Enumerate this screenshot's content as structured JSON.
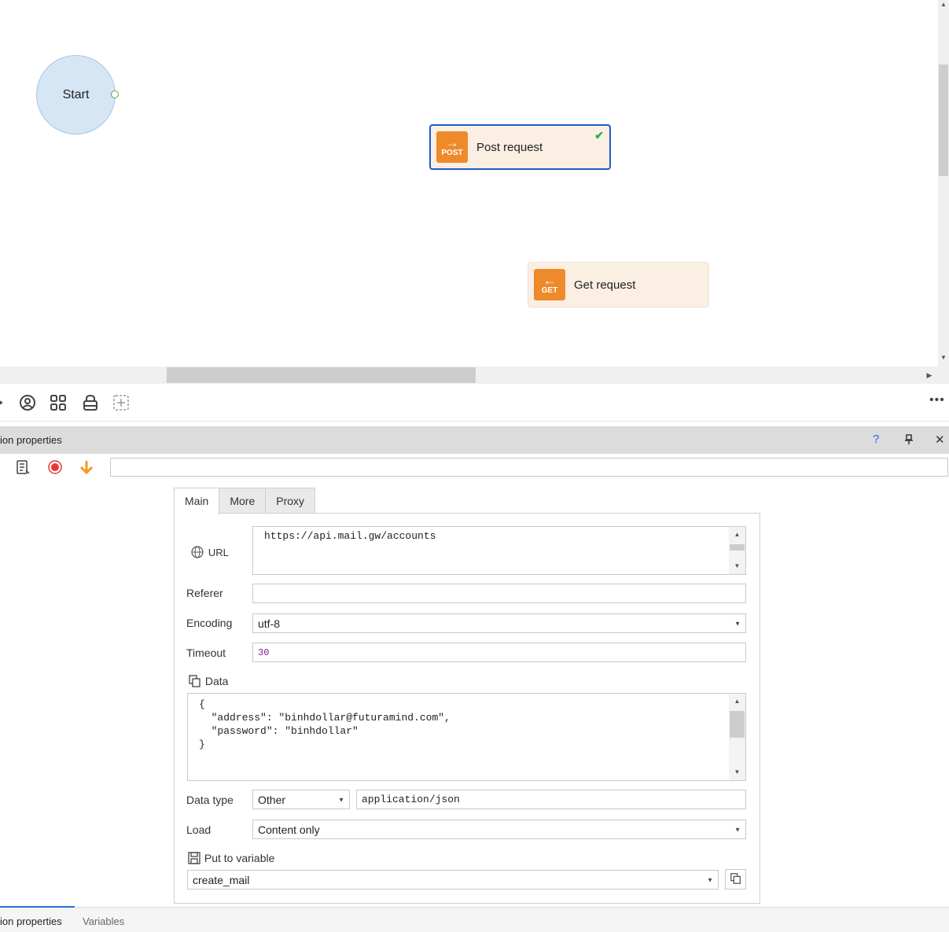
{
  "canvas": {
    "start_label": "Start",
    "nodes": [
      {
        "label": "Post request",
        "icon_tag": "POST",
        "icon": "arrow-right-icon",
        "selected": true,
        "status": "check"
      },
      {
        "label": "Get request",
        "icon_tag": "GET",
        "icon": "arrow-left-icon",
        "selected": false
      }
    ]
  },
  "panel": {
    "title": "ion properties",
    "help": "?",
    "pin": "📌",
    "close": "✕"
  },
  "form": {
    "tabs": [
      "Main",
      "More",
      "Proxy"
    ],
    "active_tab": "Main",
    "url_label": "URL",
    "url_value": "https://api.mail.gw/accounts",
    "referer_label": "Referer",
    "referer_value": "",
    "encoding_label": "Encoding",
    "encoding_value": "utf-8",
    "timeout_label": "Timeout",
    "timeout_value": "30",
    "data_label": "Data",
    "data_lines": [
      "{",
      "  \"address\": \"binhdollar@futuramind.com\",",
      "  \"password\": \"binhdollar\"",
      "}"
    ],
    "data_type_label": "Data type",
    "data_type_value": "Other",
    "content_type_value": "application/json",
    "load_label": "Load",
    "load_value": "Content only",
    "put_label": "Put to variable",
    "variable_value": "create_mail"
  },
  "bottom_tabs": [
    "ion properties",
    "Variables"
  ],
  "colors": {
    "accent": "#1e5bc6",
    "node_icon": "#ee8a2a",
    "node_bg": "#fbeee3",
    "start_bg": "#d6e6f5",
    "record": "#e53935",
    "down_arrow": "#f29a1e",
    "timeout_text": "#8b1a8b"
  }
}
